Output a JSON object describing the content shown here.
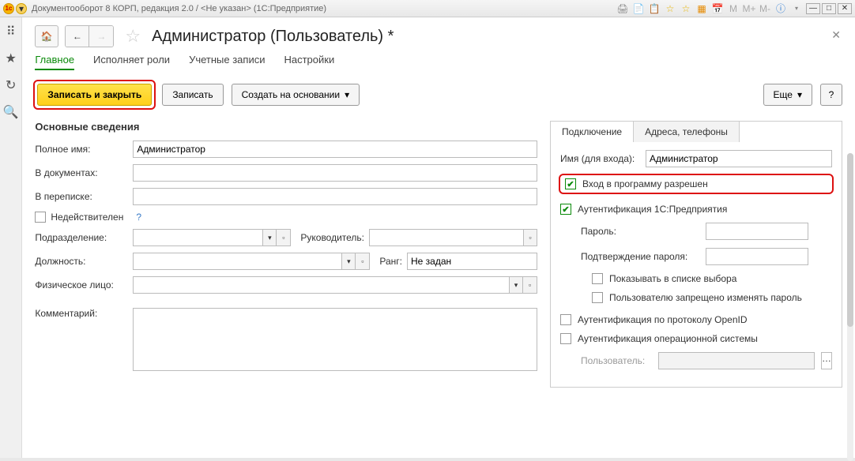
{
  "titlebar": {
    "text": "Документооборот 8 КОРП, редакция 2.0 / <Не указан>  (1С:Предприятие)",
    "m_labels": [
      "M",
      "M+",
      "M-"
    ]
  },
  "page": {
    "title": "Администратор (Пользователь) *"
  },
  "tabs": {
    "main": "Главное",
    "roles": "Исполняет роли",
    "accounts": "Учетные записи",
    "settings": "Настройки"
  },
  "toolbar": {
    "save_close": "Записать и закрыть",
    "save": "Записать",
    "create_based": "Создать на основании",
    "more": "Еще",
    "help": "?"
  },
  "section": {
    "basic": "Основные сведения"
  },
  "left": {
    "full_name_label": "Полное имя:",
    "full_name_value": "Администратор",
    "in_docs_label": "В документах:",
    "in_corr_label": "В переписке:",
    "inactive_label": "Недействителен",
    "help_q": "?",
    "department_label": "Подразделение:",
    "manager_label": "Руководитель:",
    "position_label": "Должность:",
    "rank_label": "Ранг:",
    "rank_value": "Не задан",
    "person_label": "Физическое лицо:",
    "comment_label": "Комментарий:"
  },
  "right": {
    "tab_connection": "Подключение",
    "tab_addresses": "Адреса, телефоны",
    "login_label": "Имя (для входа):",
    "login_value": "Администратор",
    "allow_login": "Вход в программу разрешен",
    "auth_1c": "Аутентификация 1С:Предприятия",
    "password_label": "Пароль:",
    "password_confirm_label": "Подтверждение пароля:",
    "show_in_list": "Показывать в списке выбора",
    "forbid_change": "Пользователю запрещено изменять пароль",
    "auth_openid": "Аутентификация по протоколу OpenID",
    "auth_os": "Аутентификация операционной системы",
    "user_label": "Пользователь:"
  }
}
